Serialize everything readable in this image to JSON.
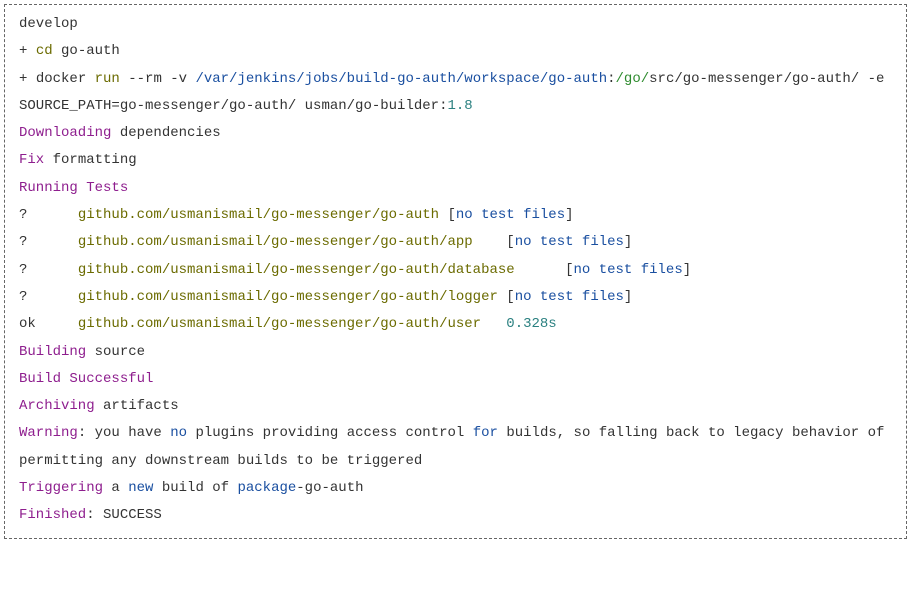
{
  "console": {
    "branch": "develop",
    "cmd1_plus": "+ ",
    "cmd1_cd": "cd",
    "cmd1_rest": " go-auth",
    "cmd2_plus": "+ ",
    "cmd2_docker": "docker ",
    "cmd2_run": "run ",
    "cmd2_flags": "--rm -v ",
    "cmd2_path1": "/var/jenkins/jobs/build-go-auth/workspace/go-auth",
    "cmd2_colon1": ":",
    "cmd2_path2": "/go/",
    "cmd2_rest1": "src/go-messenger/go-auth/ -e SOURCE_PATH=go-messenger/go-auth/ usman/go-builder:",
    "cmd2_version": "1.8",
    "downloading_kw": "Downloading",
    "downloading_rest": " dependencies",
    "fix_kw": "Fix",
    "fix_rest": " formatting",
    "running_tests": "Running Tests",
    "test1_q": "?      ",
    "test1_pkg": "github.com/usmanismail/go-messenger/go-auth ",
    "test1_lb": "[",
    "test1_msg": "no test files",
    "test1_rb": "]",
    "test2_q": "?      ",
    "test2_pkg": "github.com/usmanismail/go-messenger/go-auth/app    ",
    "test2_lb": "[",
    "test2_msg": "no test files",
    "test2_rb": "]",
    "test3_q": "?      ",
    "test3_pkg": "github.com/usmanismail/go-messenger/go-auth/database      ",
    "test3_lb": "[",
    "test3_msg": "no test files",
    "test3_rb": "]",
    "test4_q": "?      ",
    "test4_pkg": "github.com/usmanismail/go-messenger/go-auth/logger ",
    "test4_lb": "[",
    "test4_msg": "no test files",
    "test4_rb": "]",
    "test5_ok": "ok     ",
    "test5_pkg": "github.com/usmanismail/go-messenger/go-auth/user   ",
    "test5_time": "0.328s",
    "building_kw": "Building",
    "building_rest": " source",
    "build_success": "Build Successful",
    "archiving_kw": "Archiving",
    "archiving_rest": " artifacts",
    "warning_kw": "Warning",
    "warning_colon": ": ",
    "warning_you_have": "you have ",
    "warning_no": "no",
    "warning_mid": " plugins providing access control ",
    "warning_for": "for",
    "warning_rest": " builds, so falling back to legacy behavior of permitting any downstream builds to be triggered",
    "triggering_kw": "Triggering",
    "triggering_a": " a ",
    "triggering_new": "new",
    "triggering_mid": " build of ",
    "triggering_pkg": "package",
    "triggering_rest": "-go-auth",
    "finished_kw": "Finished",
    "finished_rest": ": SUCCESS"
  }
}
